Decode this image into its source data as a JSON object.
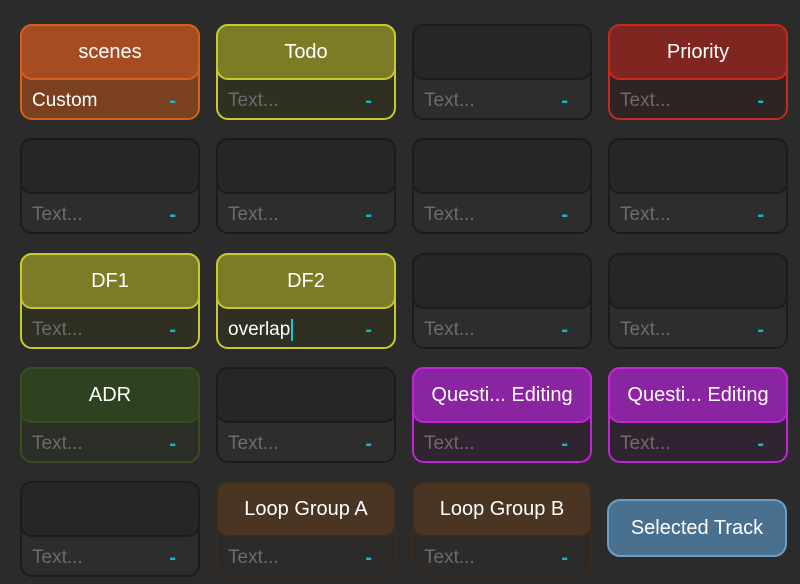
{
  "colors": {
    "orange": {
      "border": "#d65f1c",
      "fill": "#7a4020",
      "head": "#a64c23"
    },
    "olive": {
      "border": "#c8c832",
      "fill": "#2f2f22",
      "head": "#7c7c26"
    },
    "red": {
      "border": "#c42a1e",
      "fill": "#2f2424",
      "head": "#802620"
    },
    "darkgreen": {
      "border": "#3a4d1d",
      "fill": "#2c2e28",
      "head": "#2f4220"
    },
    "purple": {
      "border": "#c026d3",
      "fill": "#2f2430",
      "head": "#8a24a0"
    },
    "brown": {
      "border": "#3a2b1e",
      "fill": "#2d2b29",
      "head": "#4a3522"
    },
    "empty": {
      "border": "#1c1c1c",
      "fill": "#2d2d2d",
      "head": "#262626"
    }
  },
  "placeholder": "Text...",
  "dash": "-",
  "cells": [
    {
      "name": "scenes",
      "color": "orange",
      "value": "Custom"
    },
    {
      "name": "Todo",
      "color": "olive",
      "value": ""
    },
    {
      "name": "",
      "color": "empty",
      "value": ""
    },
    {
      "name": "Priority",
      "color": "red",
      "value": ""
    },
    {
      "name": "",
      "color": "empty",
      "value": ""
    },
    {
      "name": "",
      "color": "empty",
      "value": ""
    },
    {
      "name": "",
      "color": "empty",
      "value": ""
    },
    {
      "name": "",
      "color": "empty",
      "value": ""
    },
    {
      "name": "DF1",
      "color": "olive",
      "value": ""
    },
    {
      "name": "DF2",
      "color": "olive",
      "value": "overlap",
      "focused": true
    },
    {
      "name": "",
      "color": "empty",
      "value": ""
    },
    {
      "name": "",
      "color": "empty",
      "value": ""
    },
    {
      "name": "ADR",
      "color": "darkgreen",
      "value": ""
    },
    {
      "name": "",
      "color": "empty",
      "value": ""
    },
    {
      "name": "Questi... Editing",
      "color": "purple",
      "value": ""
    },
    {
      "name": "Questi... Editing",
      "color": "purple",
      "value": ""
    },
    {
      "name": "",
      "color": "empty",
      "value": ""
    },
    {
      "name": "Loop Group A",
      "color": "brown",
      "value": ""
    },
    {
      "name": "Loop Group B",
      "color": "brown",
      "value": ""
    }
  ],
  "selected_track": {
    "label": "Selected Track"
  }
}
